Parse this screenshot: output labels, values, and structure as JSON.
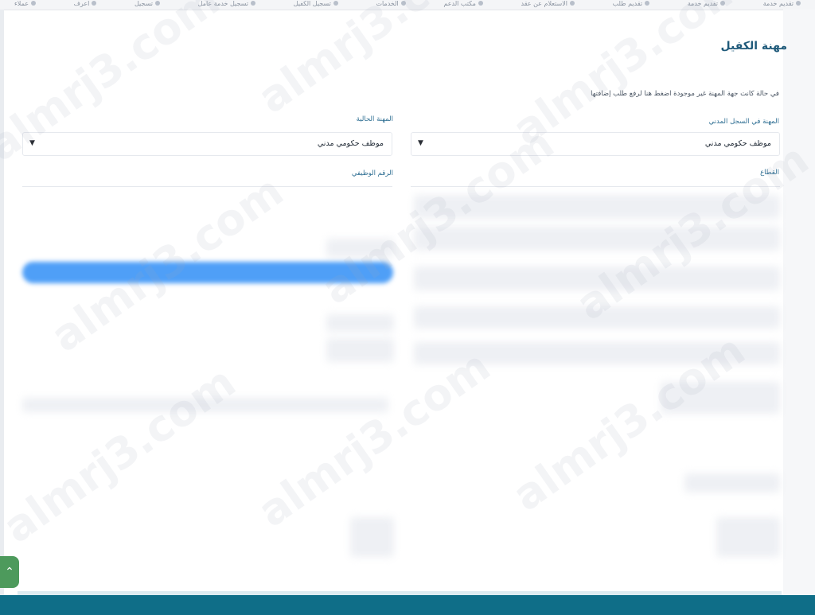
{
  "topnav": {
    "items": [
      {
        "label": "عملاء",
        "icon": "dot-icon"
      },
      {
        "label": "اعرف",
        "icon": "dot-icon"
      },
      {
        "label": "تسجيل",
        "icon": "dot-icon"
      },
      {
        "label": "تسجيل خدمة عامل",
        "icon": "user-icon"
      },
      {
        "label": "تسجيل الكفيل",
        "icon": "pin-icon"
      },
      {
        "label": "الخدمات",
        "icon": "dot-icon"
      },
      {
        "label": "مكتب الدعم",
        "icon": "dot-icon"
      },
      {
        "label": "الاستعلام عن عقد",
        "icon": "dot-icon"
      },
      {
        "label": "تقديم طلب",
        "icon": "dot-icon"
      },
      {
        "label": "تقديم خدمة",
        "icon": "dot-icon"
      },
      {
        "label": "تقديم خدمة",
        "icon": "calendar-icon"
      }
    ]
  },
  "page": {
    "section_title": "مهنة الكفيل",
    "notice_link": "في حالة كانت جهة المهنة غير موجودة اضغط هنا لرفع طلب إضافتها"
  },
  "form": {
    "right": {
      "occupation_registry_label": "المهنة في السجل المدني",
      "occupation_registry_value": "موظف حكومي مدني",
      "sector_label": "القطاع"
    },
    "left": {
      "current_occupation_label": "المهنة الحالية",
      "current_occupation_value": "موظف حكومي مدني",
      "job_number_label": "الرقم الوظيفي"
    }
  },
  "watermark": {
    "text": "almrj3.com"
  }
}
